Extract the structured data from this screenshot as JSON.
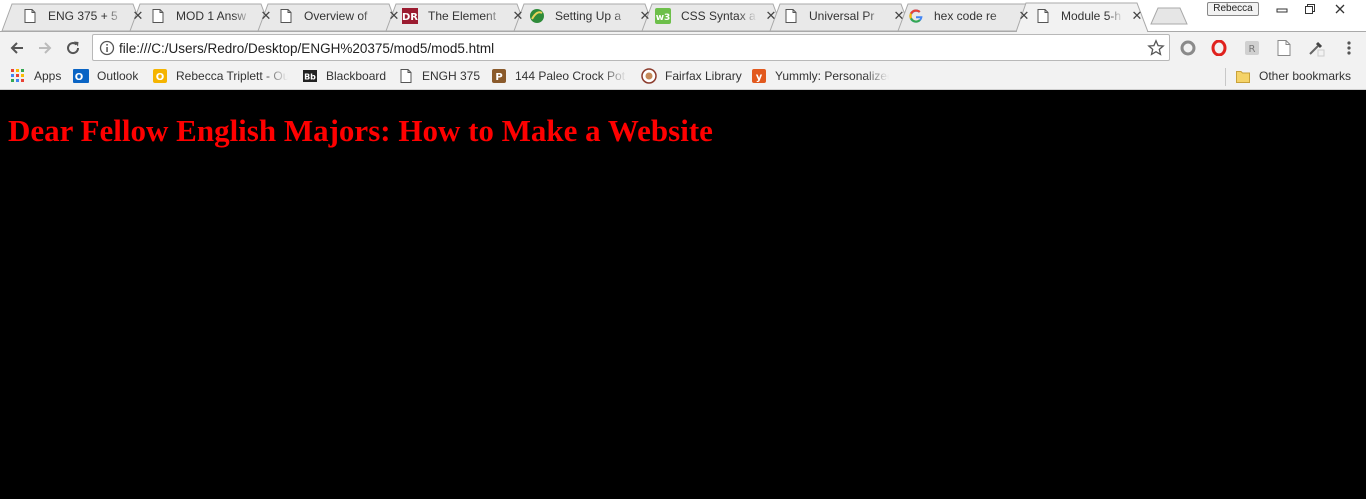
{
  "window": {
    "profile_name": "Rebecca",
    "controls": {
      "minimize": "minimize",
      "restore": "restore",
      "close": "close"
    }
  },
  "tabs": [
    {
      "title": "ENG 375 + 5",
      "icon": "page-icon",
      "active": false
    },
    {
      "title": "MOD 1 Answ",
      "icon": "page-icon",
      "active": false
    },
    {
      "title": "Overview of",
      "icon": "page-icon",
      "active": false
    },
    {
      "title": "The Element",
      "icon": "dr-logo-icon",
      "active": false
    },
    {
      "title": "Setting Up a",
      "icon": "leaf-logo-icon",
      "active": false
    },
    {
      "title": "CSS Syntax a",
      "icon": "w3-logo-icon",
      "active": false
    },
    {
      "title": "Universal Pr",
      "icon": "page-icon",
      "active": false
    },
    {
      "title": "hex code re",
      "icon": "google-g-icon",
      "active": false
    },
    {
      "title": "Module 5-h",
      "icon": "page-icon",
      "active": true
    }
  ],
  "toolbar": {
    "url": "file:///C:/Users/Redro/Desktop/ENGH%20375/mod5/mod5.html"
  },
  "bookmarks": [
    {
      "label": "Apps",
      "icon": "apps-grid-icon"
    },
    {
      "label": "Outlook",
      "icon": "outlook-icon"
    },
    {
      "label": "Rebecca Triplett - Out",
      "icon": "o-badge-icon"
    },
    {
      "label": "Blackboard",
      "icon": "blackboard-icon"
    },
    {
      "label": "ENGH 375",
      "icon": "page-icon"
    },
    {
      "label": "144 Paleo Crock Pot R",
      "icon": "p-badge-icon"
    },
    {
      "label": "Fairfax Library",
      "icon": "library-seal-icon"
    },
    {
      "label": "Yummly: Personalized",
      "icon": "yummly-icon"
    }
  ],
  "other_bookmarks": "Other bookmarks",
  "page": {
    "heading": "Dear Fellow English Majors: How to Make a Website"
  },
  "colors": {
    "page_background": "#000000",
    "heading": "#ff0000",
    "toolbar": "#f2f2f2",
    "tabstrip": "#ffffff"
  }
}
